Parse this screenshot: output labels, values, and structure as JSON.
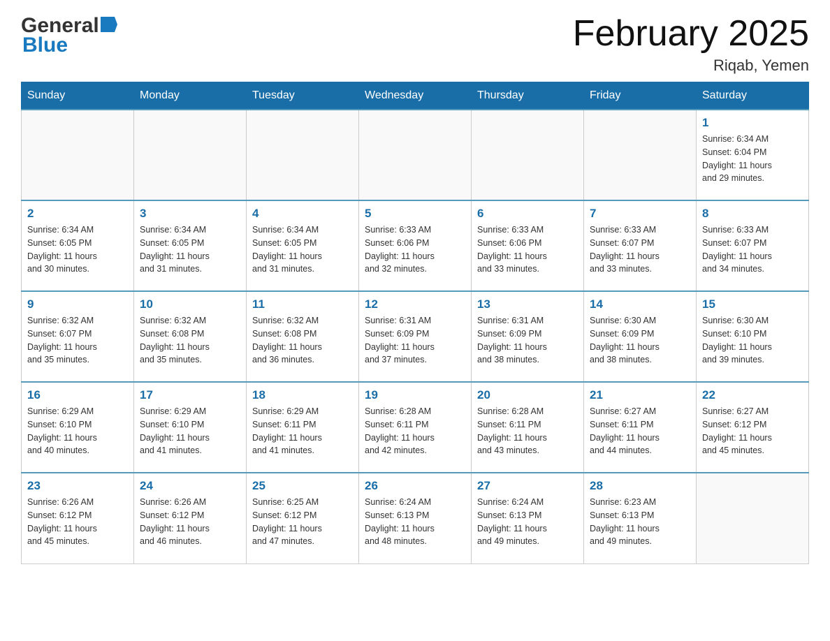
{
  "header": {
    "logo_general": "General",
    "logo_blue": "Blue",
    "month_title": "February 2025",
    "location": "Riqab, Yemen"
  },
  "days_of_week": [
    "Sunday",
    "Monday",
    "Tuesday",
    "Wednesday",
    "Thursday",
    "Friday",
    "Saturday"
  ],
  "weeks": [
    {
      "days": [
        {
          "date": "",
          "info": ""
        },
        {
          "date": "",
          "info": ""
        },
        {
          "date": "",
          "info": ""
        },
        {
          "date": "",
          "info": ""
        },
        {
          "date": "",
          "info": ""
        },
        {
          "date": "",
          "info": ""
        },
        {
          "date": "1",
          "info": "Sunrise: 6:34 AM\nSunset: 6:04 PM\nDaylight: 11 hours\nand 29 minutes."
        }
      ]
    },
    {
      "days": [
        {
          "date": "2",
          "info": "Sunrise: 6:34 AM\nSunset: 6:05 PM\nDaylight: 11 hours\nand 30 minutes."
        },
        {
          "date": "3",
          "info": "Sunrise: 6:34 AM\nSunset: 6:05 PM\nDaylight: 11 hours\nand 31 minutes."
        },
        {
          "date": "4",
          "info": "Sunrise: 6:34 AM\nSunset: 6:05 PM\nDaylight: 11 hours\nand 31 minutes."
        },
        {
          "date": "5",
          "info": "Sunrise: 6:33 AM\nSunset: 6:06 PM\nDaylight: 11 hours\nand 32 minutes."
        },
        {
          "date": "6",
          "info": "Sunrise: 6:33 AM\nSunset: 6:06 PM\nDaylight: 11 hours\nand 33 minutes."
        },
        {
          "date": "7",
          "info": "Sunrise: 6:33 AM\nSunset: 6:07 PM\nDaylight: 11 hours\nand 33 minutes."
        },
        {
          "date": "8",
          "info": "Sunrise: 6:33 AM\nSunset: 6:07 PM\nDaylight: 11 hours\nand 34 minutes."
        }
      ]
    },
    {
      "days": [
        {
          "date": "9",
          "info": "Sunrise: 6:32 AM\nSunset: 6:07 PM\nDaylight: 11 hours\nand 35 minutes."
        },
        {
          "date": "10",
          "info": "Sunrise: 6:32 AM\nSunset: 6:08 PM\nDaylight: 11 hours\nand 35 minutes."
        },
        {
          "date": "11",
          "info": "Sunrise: 6:32 AM\nSunset: 6:08 PM\nDaylight: 11 hours\nand 36 minutes."
        },
        {
          "date": "12",
          "info": "Sunrise: 6:31 AM\nSunset: 6:09 PM\nDaylight: 11 hours\nand 37 minutes."
        },
        {
          "date": "13",
          "info": "Sunrise: 6:31 AM\nSunset: 6:09 PM\nDaylight: 11 hours\nand 38 minutes."
        },
        {
          "date": "14",
          "info": "Sunrise: 6:30 AM\nSunset: 6:09 PM\nDaylight: 11 hours\nand 38 minutes."
        },
        {
          "date": "15",
          "info": "Sunrise: 6:30 AM\nSunset: 6:10 PM\nDaylight: 11 hours\nand 39 minutes."
        }
      ]
    },
    {
      "days": [
        {
          "date": "16",
          "info": "Sunrise: 6:29 AM\nSunset: 6:10 PM\nDaylight: 11 hours\nand 40 minutes."
        },
        {
          "date": "17",
          "info": "Sunrise: 6:29 AM\nSunset: 6:10 PM\nDaylight: 11 hours\nand 41 minutes."
        },
        {
          "date": "18",
          "info": "Sunrise: 6:29 AM\nSunset: 6:11 PM\nDaylight: 11 hours\nand 41 minutes."
        },
        {
          "date": "19",
          "info": "Sunrise: 6:28 AM\nSunset: 6:11 PM\nDaylight: 11 hours\nand 42 minutes."
        },
        {
          "date": "20",
          "info": "Sunrise: 6:28 AM\nSunset: 6:11 PM\nDaylight: 11 hours\nand 43 minutes."
        },
        {
          "date": "21",
          "info": "Sunrise: 6:27 AM\nSunset: 6:11 PM\nDaylight: 11 hours\nand 44 minutes."
        },
        {
          "date": "22",
          "info": "Sunrise: 6:27 AM\nSunset: 6:12 PM\nDaylight: 11 hours\nand 45 minutes."
        }
      ]
    },
    {
      "days": [
        {
          "date": "23",
          "info": "Sunrise: 6:26 AM\nSunset: 6:12 PM\nDaylight: 11 hours\nand 45 minutes."
        },
        {
          "date": "24",
          "info": "Sunrise: 6:26 AM\nSunset: 6:12 PM\nDaylight: 11 hours\nand 46 minutes."
        },
        {
          "date": "25",
          "info": "Sunrise: 6:25 AM\nSunset: 6:12 PM\nDaylight: 11 hours\nand 47 minutes."
        },
        {
          "date": "26",
          "info": "Sunrise: 6:24 AM\nSunset: 6:13 PM\nDaylight: 11 hours\nand 48 minutes."
        },
        {
          "date": "27",
          "info": "Sunrise: 6:24 AM\nSunset: 6:13 PM\nDaylight: 11 hours\nand 49 minutes."
        },
        {
          "date": "28",
          "info": "Sunrise: 6:23 AM\nSunset: 6:13 PM\nDaylight: 11 hours\nand 49 minutes."
        },
        {
          "date": "",
          "info": ""
        }
      ]
    }
  ]
}
